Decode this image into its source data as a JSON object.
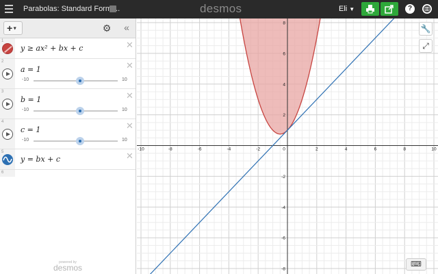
{
  "header": {
    "doc_title": "Parabolas: Standard Form ...",
    "brand": "desmos",
    "user": "Eli",
    "help_label": "?",
    "accent": "#2ea83a"
  },
  "panel": {
    "add_label": "+",
    "powered_small": "powered by",
    "powered_big": "desmos",
    "expressions": [
      {
        "num": "1",
        "latex": "y ≥ ax² + bx + c",
        "icon": "shade-icon",
        "color": "#c74440"
      },
      {
        "num": "2",
        "latex": "a = 1",
        "icon": "play-icon",
        "slider": {
          "min": "-10",
          "max": "10",
          "value": 1
        }
      },
      {
        "num": "3",
        "latex": "b = 1",
        "icon": "play-icon",
        "slider": {
          "min": "-10",
          "max": "10",
          "value": 1
        }
      },
      {
        "num": "4",
        "latex": "c = 1",
        "icon": "play-icon",
        "slider": {
          "min": "-10",
          "max": "10",
          "value": 1
        }
      },
      {
        "num": "5",
        "latex": "y = bx + c",
        "icon": "wave-icon",
        "color": "#2d70b3"
      }
    ],
    "empty_num": "6"
  },
  "graph": {
    "xlim": [
      -10,
      10
    ],
    "ylim": [
      -8,
      8
    ],
    "x_ticks": [
      "-10",
      "-8",
      "-6",
      "-4",
      "-2",
      "0",
      "2",
      "4",
      "6",
      "8",
      "10"
    ],
    "y_ticks": [
      "-8",
      "-6",
      "-4",
      "-2",
      "2",
      "4",
      "6",
      "8"
    ],
    "grid": true,
    "parabola": {
      "a": 1,
      "b": 1,
      "c": 1,
      "color": "#c74440",
      "fill": "#e8a5a3"
    },
    "line": {
      "b": 1,
      "c": 1,
      "color": "#2d70b3"
    }
  }
}
